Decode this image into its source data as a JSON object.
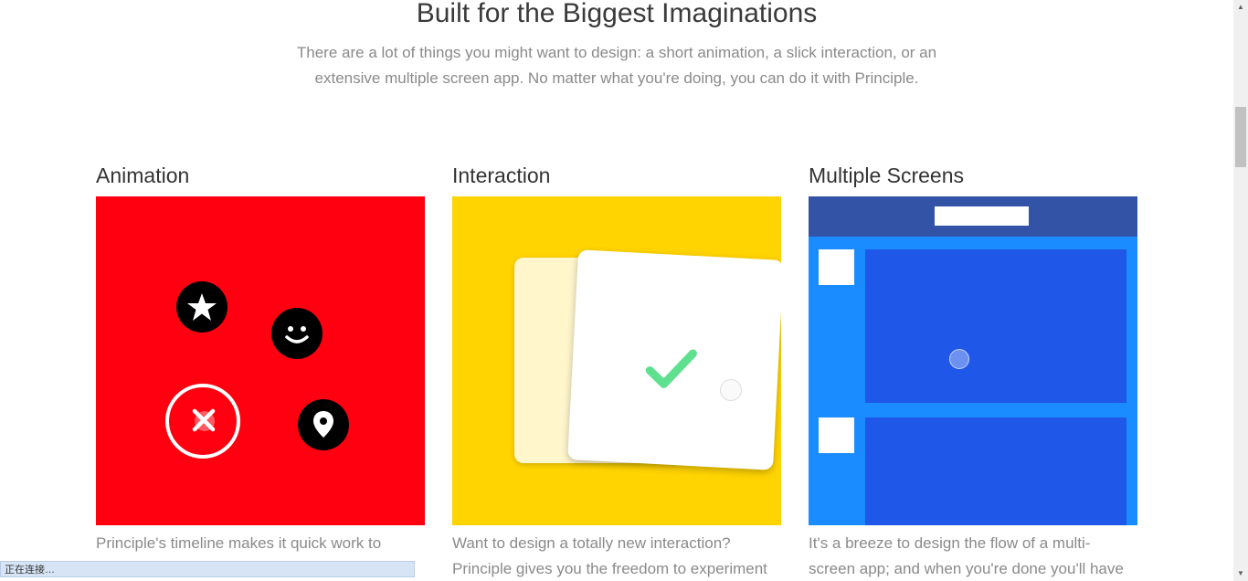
{
  "section": {
    "title": "Built for the Biggest Imaginations",
    "subtitle_line1": "There are a lot of things you might want to design: a short animation, a slick interaction, or an",
    "subtitle_line2": "extensive multiple screen app. No matter what you're doing, you can do it with Principle."
  },
  "features": [
    {
      "heading": "Animation",
      "tile_color": "#ff0010",
      "icons": [
        "star-icon",
        "smiley-icon",
        "close-icon",
        "map-pin-icon"
      ],
      "desc_line1": "Principle's timeline makes it quick work to",
      "desc_line2": ""
    },
    {
      "heading": "Interaction",
      "tile_color": "#ffd400",
      "icons": [
        "checkmark-icon"
      ],
      "desc_line1": "Want to design a totally new interaction?",
      "desc_line2": "Principle gives you the freedom to experiment"
    },
    {
      "heading": "Multiple Screens",
      "tile_color": "#1b8cff",
      "header_color": "#3353a6",
      "panel_color": "#1f57e8",
      "desc_line1": "It's a breeze to design the flow of a multi-",
      "desc_line2": "screen app; and when you're done you'll have"
    }
  ],
  "status_bar": {
    "text": "正在连接…"
  }
}
